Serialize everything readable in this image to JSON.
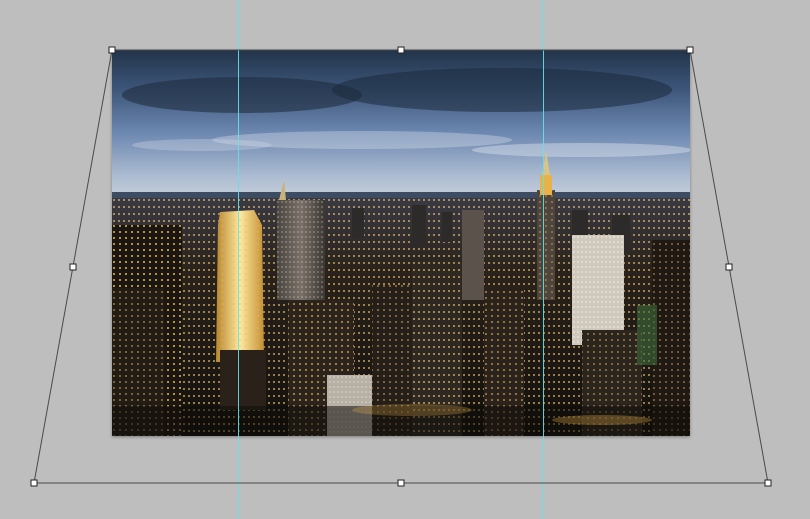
{
  "canvas": {
    "background_color": "#bebebe"
  },
  "image": {
    "subject": "",
    "sky_top_color": "#27384f",
    "sky_mid_color": "#5f7ba6",
    "sky_horizon_color": "#b9c5d6",
    "city_base_color": "#15120f",
    "window_light_color": "#f3b64a"
  },
  "guides": {
    "color": "#5fe3ea",
    "count": 2
  },
  "transform": {
    "handle_color": "#ffffff",
    "line_color": "#4a4a4a",
    "handles": [
      "top-left",
      "top-center",
      "top-right",
      "middle-left",
      "middle-right",
      "bottom-left",
      "bottom-center",
      "bottom-right"
    ]
  }
}
